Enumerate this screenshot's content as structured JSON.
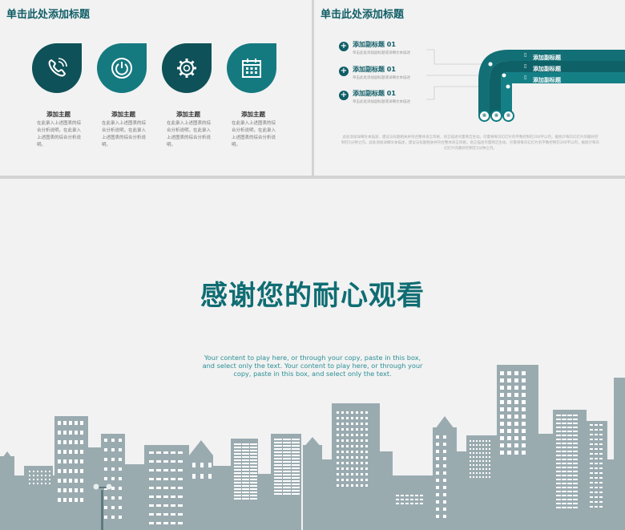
{
  "slide1": {
    "title": "单击此处添加标题",
    "items": [
      {
        "icon": "phone-icon",
        "title": "添加主题",
        "desc": "在此录入上述图表的综合分析说明，在此录入上述图表的综合分析说明。"
      },
      {
        "icon": "power-icon",
        "title": "添加主题",
        "desc": "在此录入上述图表的综合分析说明，在此录入上述图表的综合分析说明。"
      },
      {
        "icon": "gear-icon",
        "title": "添加主题",
        "desc": "在此录入上述图表的综合分析说明，在此录入上述图表的综合分析说明。"
      },
      {
        "icon": "calendar-icon",
        "title": "添加主题",
        "desc": "在此录入上述图表的综合分析说明，在此录入上述图表的综合分析说明。"
      }
    ]
  },
  "slide2": {
    "title": "单击此处添加标题",
    "subs": [
      {
        "title": "添加副标题 01",
        "desc": "单击此处添加副标题或详细文本描述"
      },
      {
        "title": "添加副标题 01",
        "desc": "单击此处添加副标题或详细文本描述"
      },
      {
        "title": "添加副标题 01",
        "desc": "单击此处添加副标题或详细文本描述"
      }
    ],
    "band_labels": [
      "添加副标题",
      "添加副标题",
      "添加副标题"
    ],
    "note": "此处添加详细文本描述，建议与标题相关并符合整体语言风格，语言描述尽量简洁生动。尽量将每页幻灯片的字数控制在200字以内，据统计每页幻灯片的最好控制在5分钟之内。此处添加详细文本描述，建议与标题相关并符合整体语言风格，语言描述尽量简洁生动。尽量将每页幻灯片的字数控制在200字以内，据统计每页幻灯片的最好控制在5分钟之内。"
  },
  "slide3": {
    "thanks": "感谢您的耐心观看",
    "content": "Your content to play here, or through your copy, paste in this box, and select only the text. Your content to play here, or through your copy, paste in this box, and select only the text."
  },
  "colors": {
    "teal_dark": "#0f5d66",
    "teal": "#137a80",
    "city": "#9aabb0",
    "window": "#ffffff"
  }
}
